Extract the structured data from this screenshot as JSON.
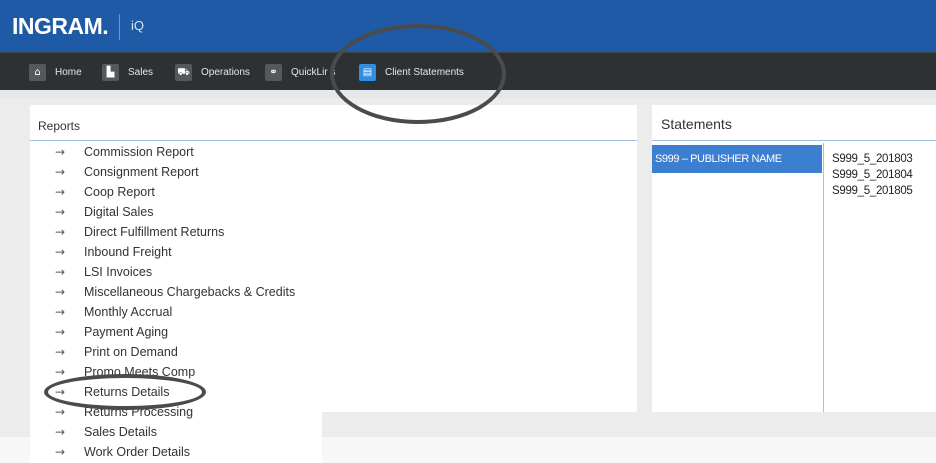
{
  "brand": {
    "logo": "INGRAM.",
    "product": "iQ"
  },
  "nav": {
    "items": [
      {
        "label": "Home",
        "icon": "home-icon",
        "glyph": "⌂"
      },
      {
        "label": "Sales",
        "icon": "bar-chart-icon",
        "glyph": "▙"
      },
      {
        "label": "Operations",
        "icon": "truck-icon",
        "glyph": "⛟"
      },
      {
        "label": "QuickLir s",
        "icon": "link-icon",
        "glyph": "⚭"
      },
      {
        "label": "Client Statements",
        "icon": "document-icon",
        "glyph": "▤"
      }
    ],
    "active_index": 4,
    "active_color": "#2f8fe0"
  },
  "reports": {
    "title": "Reports",
    "arrow": "→",
    "items": [
      "Commission Report",
      "Consignment Report",
      "Coop Report",
      "Digital Sales",
      "Direct Fulfillment Returns",
      "Inbound Freight",
      "LSI Invoices",
      "Miscellaneous Chargebacks & Credits",
      "Monthly Accrual",
      "Payment Aging",
      "Print on Demand",
      "Promo Meets Comp",
      "Returns Details",
      "Returns Processing",
      "Sales Details",
      "Work Order Details"
    ]
  },
  "statements": {
    "title": "Statements",
    "publisher": "S999 – PUBLISHER NAME",
    "files": [
      "S999_5_201803",
      "S999_5_201804",
      "S999_5_201805"
    ]
  },
  "colors": {
    "brand_bar": "#1e5aa6",
    "nav_bar": "#2e3134",
    "selected_row": "#3c7ed0",
    "annotation": "#4b4b4b"
  }
}
